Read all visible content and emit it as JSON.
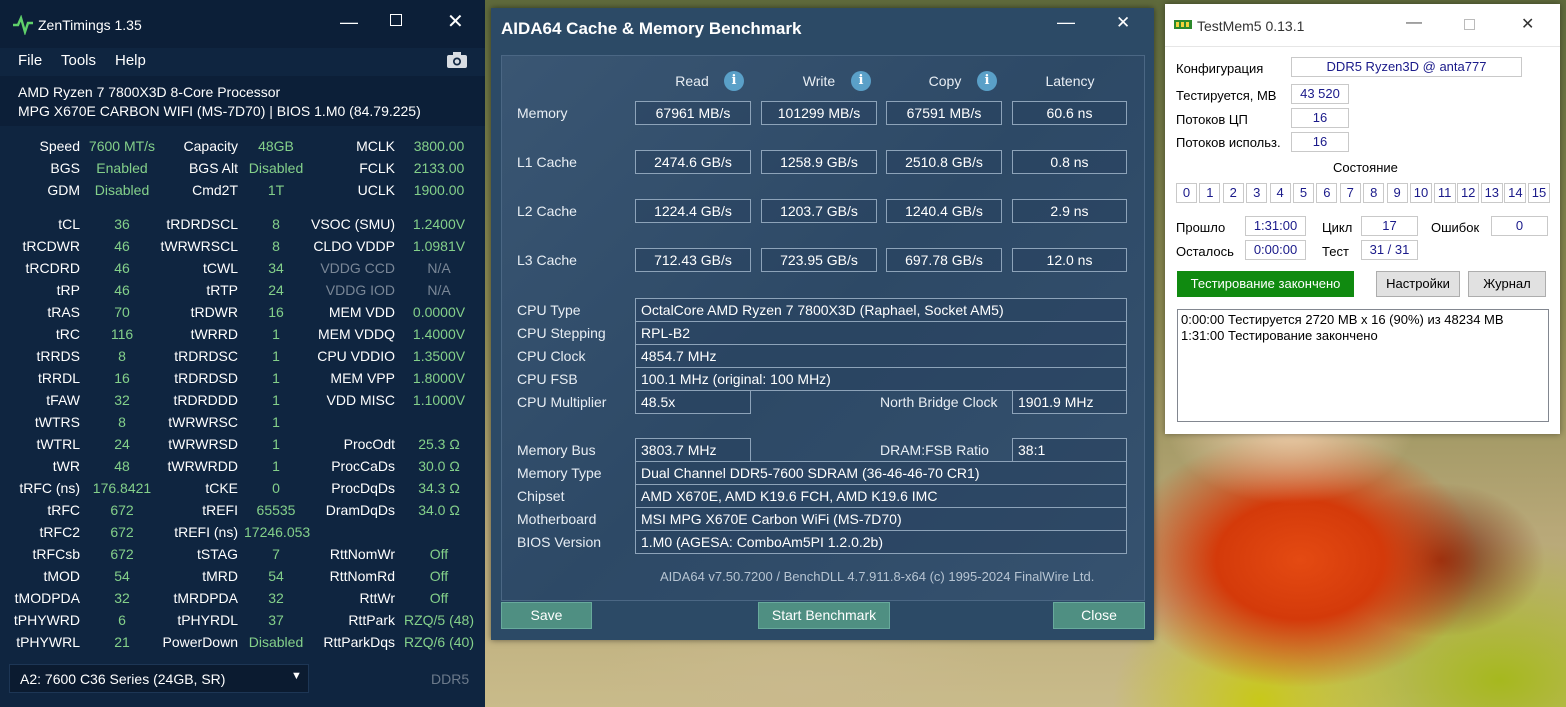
{
  "zen": {
    "title": "ZenTimings 1.35",
    "menu": [
      "File",
      "Tools",
      "Help"
    ],
    "cpu": "AMD Ryzen 7 7800X3D 8-Core Processor",
    "board": "MPG X670E CARBON WIFI (MS-7D70) | BIOS 1.M0 (84.79.225)",
    "rows": [
      [
        "Speed",
        "7600 MT/s",
        "Capacity",
        "48GB",
        "MCLK",
        "3800.00"
      ],
      [
        "BGS",
        "Enabled",
        "BGS Alt",
        "Disabled",
        "FCLK",
        "2133.00"
      ],
      [
        "GDM",
        "Disabled",
        "Cmd2T",
        "1T",
        "UCLK",
        "1900.00"
      ],
      [
        "tCL",
        "36",
        "tRDRDSCL",
        "8",
        "VSOC (SMU)",
        "1.2400V"
      ],
      [
        "tRCDWR",
        "46",
        "tWRWRSCL",
        "8",
        "CLDO VDDP",
        "1.0981V"
      ],
      [
        "tRCDRD",
        "46",
        "tCWL",
        "34",
        "VDDG CCD",
        "N/A"
      ],
      [
        "tRP",
        "46",
        "tRTP",
        "24",
        "VDDG IOD",
        "N/A"
      ],
      [
        "tRAS",
        "70",
        "tRDWR",
        "16",
        "MEM VDD",
        "0.0000V"
      ],
      [
        "tRC",
        "116",
        "tWRRD",
        "1",
        "MEM VDDQ",
        "1.4000V"
      ],
      [
        "tRRDS",
        "8",
        "tRDRDSC",
        "1",
        "CPU VDDIO",
        "1.3500V"
      ],
      [
        "tRRDL",
        "16",
        "tRDRDSD",
        "1",
        "MEM VPP",
        "1.8000V"
      ],
      [
        "tFAW",
        "32",
        "tRDRDDD",
        "1",
        "VDD MISC",
        "1.1000V"
      ],
      [
        "tWTRS",
        "8",
        "tWRWRSC",
        "1",
        "",
        ""
      ],
      [
        "tWTRL",
        "24",
        "tWRWRSD",
        "1",
        "ProcOdt",
        "25.3 Ω"
      ],
      [
        "tWR",
        "48",
        "tWRWRDD",
        "1",
        "ProcCaDs",
        "30.0 Ω"
      ],
      [
        "tRFC (ns)",
        "176.8421",
        "tCKE",
        "0",
        "ProcDqDs",
        "34.3 Ω"
      ],
      [
        "tRFC",
        "672",
        "tREFI",
        "65535",
        "DramDqDs",
        "34.0 Ω"
      ],
      [
        "tRFC2",
        "672",
        "tREFI (ns)",
        "17246.053",
        "",
        ""
      ],
      [
        "tRFCsb",
        "672",
        "tSTAG",
        "7",
        "RttNomWr",
        "Off"
      ],
      [
        "tMOD",
        "54",
        "tMRD",
        "54",
        "RttNomRd",
        "Off"
      ],
      [
        "tMODPDA",
        "32",
        "tMRDPDA",
        "32",
        "RttWr",
        "Off"
      ],
      [
        "tPHYWRD",
        "6",
        "tPHYRDL",
        "37",
        "RttPark",
        "RZQ/5 (48)"
      ],
      [
        "tPHYWRL",
        "21",
        "PowerDown",
        "Disabled",
        "RttParkDqs",
        "RZQ/6 (40)"
      ]
    ],
    "dimm": "A2: 7600 C36 Series (24GB, SR)",
    "ddr": "DDR5"
  },
  "aida": {
    "title": "AIDA64 Cache & Memory Benchmark",
    "headers": [
      "Read",
      "Write",
      "Copy",
      "Latency"
    ],
    "bench": [
      {
        "label": "Memory",
        "vals": [
          "67961 MB/s",
          "101299 MB/s",
          "67591 MB/s",
          "60.6 ns"
        ]
      },
      {
        "label": "L1 Cache",
        "vals": [
          "2474.6 GB/s",
          "1258.9 GB/s",
          "2510.8 GB/s",
          "0.8 ns"
        ]
      },
      {
        "label": "L2 Cache",
        "vals": [
          "1224.4 GB/s",
          "1203.7 GB/s",
          "1240.4 GB/s",
          "2.9 ns"
        ]
      },
      {
        "label": "L3 Cache",
        "vals": [
          "712.43 GB/s",
          "723.95 GB/s",
          "697.78 GB/s",
          "12.0 ns"
        ]
      }
    ],
    "cpu_type_label": "CPU Type",
    "cpu_type": "OctalCore AMD Ryzen 7 7800X3D  (Raphael, Socket AM5)",
    "cpu_stepping_label": "CPU Stepping",
    "cpu_stepping": "RPL-B2",
    "cpu_clock_label": "CPU Clock",
    "cpu_clock": "4854.7 MHz",
    "cpu_fsb_label": "CPU FSB",
    "cpu_fsb": "100.1 MHz  (original: 100 MHz)",
    "cpu_mult_label": "CPU Multiplier",
    "cpu_mult": "48.5x",
    "nb_clock_label": "North Bridge Clock",
    "nb_clock": "1901.9 MHz",
    "mem_bus_label": "Memory Bus",
    "mem_bus": "3803.7 MHz",
    "dram_fsb_label": "DRAM:FSB Ratio",
    "dram_fsb": "38:1",
    "mem_type_label": "Memory Type",
    "mem_type": "Dual Channel DDR5-7600 SDRAM  (36-46-46-70 CR1)",
    "chipset_label": "Chipset",
    "chipset": "AMD X670E, AMD K19.6 FCH, AMD K19.6 IMC",
    "mobo_label": "Motherboard",
    "mobo": "MSI MPG X670E Carbon WiFi (MS-7D70)",
    "bios_label": "BIOS Version",
    "bios": "1.M0  (AGESA: ComboAm5PI 1.2.0.2b)",
    "footer": "AIDA64 v7.50.7200 / BenchDLL 4.7.911.8-x64  (c) 1995-2024 FinalWire Ltd.",
    "save": "Save",
    "start": "Start Benchmark",
    "close": "Close"
  },
  "tm": {
    "title": "TestMem5  0.13.1",
    "config_label": "Конфигурация",
    "config": "DDR5 Ryzen3D @ anta777",
    "tested_label": "Тестируется, МB",
    "tested": "43 520",
    "threads_label": "Потоков ЦП",
    "threads": "16",
    "used_label": "Потоков использ.",
    "used": "16",
    "state_label": "Состояние",
    "cells": [
      "0",
      "1",
      "2",
      "3",
      "4",
      "5",
      "6",
      "7",
      "8",
      "9",
      "10",
      "11",
      "12",
      "13",
      "14",
      "15"
    ],
    "elapsed_label": "Прошло",
    "elapsed": "1:31:00",
    "cycle_label": "Цикл",
    "cycle": "17",
    "errors_label": "Ошибок",
    "errors": "0",
    "remaining_label": "Осталось",
    "remaining": "0:00:00",
    "test_label": "Тест",
    "test": "31 / 31",
    "status_btn": "Тестирование закончено",
    "settings_btn": "Настройки",
    "log_btn": "Журнал",
    "log": [
      "0:00:00  Тестируется 2720 MB x 16 (90%) из 48234 МB",
      "1:31:00  Тестирование закончено"
    ]
  }
}
